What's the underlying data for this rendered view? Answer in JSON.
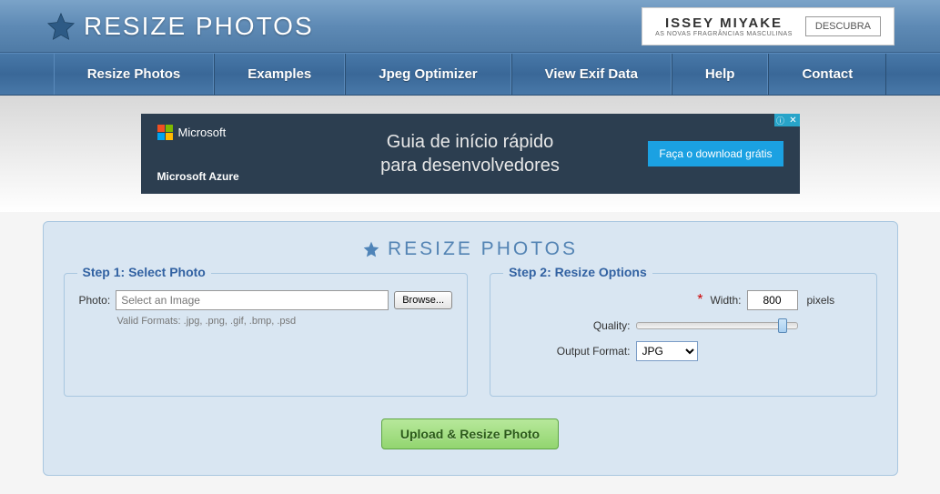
{
  "header": {
    "site_title": "RESIZE PHOTOS",
    "ad_brand": "ISSEY MIYAKE",
    "ad_tagline": "AS NOVAS FRAGRÂNCIAS MASCULINAS",
    "ad_button": "DESCUBRA"
  },
  "nav": {
    "items": [
      "Resize Photos",
      "Examples",
      "Jpeg Optimizer",
      "View Exif Data",
      "Help",
      "Contact"
    ]
  },
  "banner": {
    "ms_label": "Microsoft",
    "product": "Microsoft Azure",
    "line1": "Guia de início rápido",
    "line2": "para desenvolvedores",
    "cta": "Faça o download grátis",
    "close": "✕",
    "info": "ⓘ"
  },
  "main": {
    "heading": "RESIZE PHOTOS",
    "step1": {
      "legend": "Step 1: Select Photo",
      "photo_label": "Photo:",
      "placeholder": "Select an Image",
      "browse": "Browse...",
      "hint": "Valid Formats: .jpg, .png, .gif, .bmp, .psd"
    },
    "step2": {
      "legend": "Step 2: Resize Options",
      "width_label": "Width:",
      "width_value": "800",
      "width_unit": "pixels",
      "quality_label": "Quality:",
      "format_label": "Output Format:",
      "format_value": "JPG",
      "required_mark": "*"
    },
    "upload_button": "Upload & Resize Photo"
  }
}
